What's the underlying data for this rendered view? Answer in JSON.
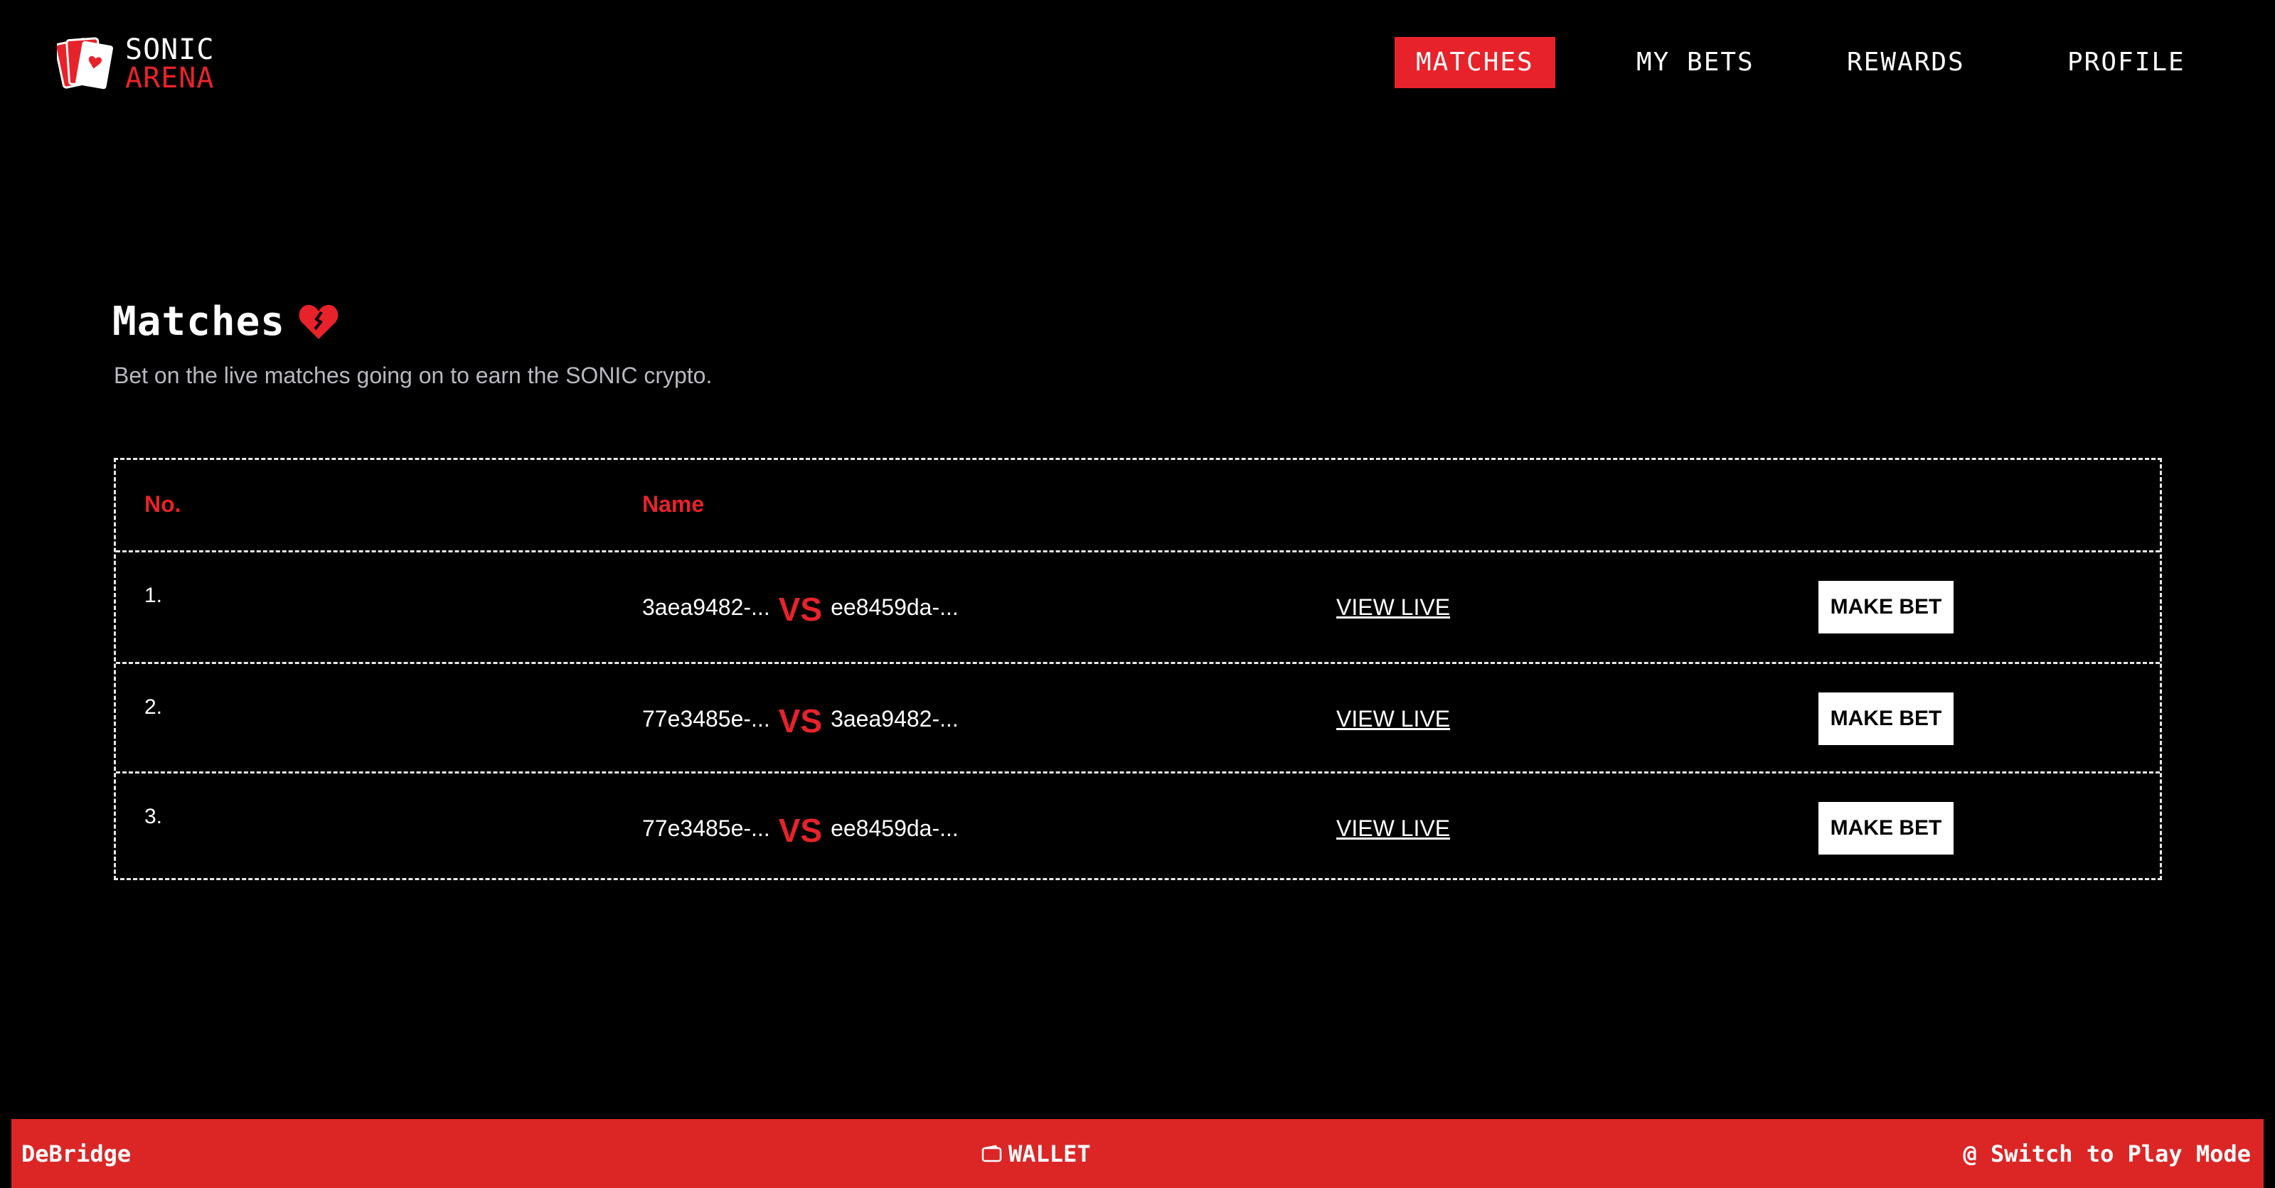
{
  "brand": {
    "name_top": "SONIC",
    "name_bottom": "ARENA",
    "accent_color": "#e8222a"
  },
  "nav": {
    "items": [
      {
        "label": "MATCHES",
        "active": true
      },
      {
        "label": "MY BETS",
        "active": false
      },
      {
        "label": "REWARDS",
        "active": false
      },
      {
        "label": "PROFILE",
        "active": false
      }
    ]
  },
  "main": {
    "title": "Matches",
    "subtitle": "Bet on the live matches going on to earn the SONIC crypto.",
    "table": {
      "headers": {
        "no": "No.",
        "name": "Name"
      },
      "rows": [
        {
          "no": "1.",
          "player_a": "3aea9482-...",
          "vs": "VS",
          "player_b": "ee8459da-...",
          "view_label": "VIEW LIVE",
          "bet_label": "MAKE BET"
        },
        {
          "no": "2.",
          "player_a": "77e3485e-...",
          "vs": "VS",
          "player_b": "3aea9482-...",
          "view_label": "VIEW LIVE",
          "bet_label": "MAKE BET"
        },
        {
          "no": "3.",
          "player_a": "77e3485e-...",
          "vs": "VS",
          "player_b": "ee8459da-...",
          "view_label": "VIEW LIVE",
          "bet_label": "MAKE BET"
        }
      ]
    }
  },
  "footer": {
    "left": "DeBridge",
    "center": "WALLET",
    "right": "@ Switch to Play Mode",
    "background": "#dc2626"
  },
  "icons": {
    "logo": "playing-cards-icon",
    "title": "heart-icon",
    "wallet": "wallet-icon"
  }
}
